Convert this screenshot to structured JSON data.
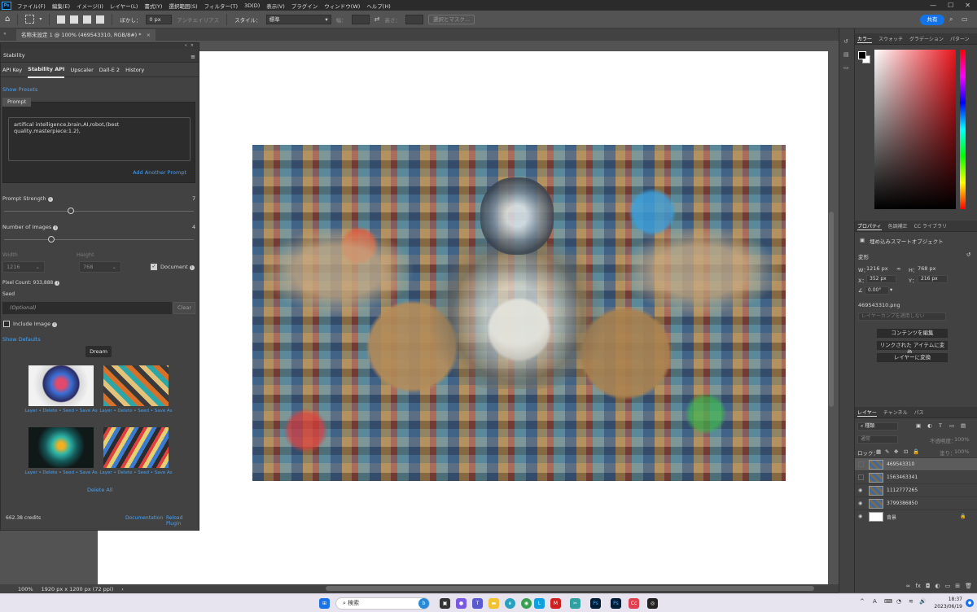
{
  "app": {
    "logo": "Ps",
    "menu": [
      "ファイル(F)",
      "編集(E)",
      "イメージ(I)",
      "レイヤー(L)",
      "書式(Y)",
      "選択範囲(S)",
      "フィルター(T)",
      "3D(D)",
      "表示(V)",
      "プラグイン",
      "ウィンドウ(W)",
      "ヘルプ(H)"
    ],
    "window_controls": [
      "—",
      "☐",
      "✕"
    ]
  },
  "options_bar": {
    "blur_label": "ぼかし：",
    "blur_value": "0 px",
    "antialias_label": "アンチエイリアス",
    "style_label": "スタイル：",
    "style_value": "標準",
    "width_label": "幅：",
    "height_label": "高さ：",
    "select_mask_label": "選択とマスク...",
    "share_label": "共有"
  },
  "document": {
    "tab_title": "名称未設定 1 @ 100% (469543310, RGB/8#) *",
    "zoom": "100%",
    "doc_size": "1920 px x 1200 px (72 ppi)"
  },
  "stability": {
    "panel_title": "Stability",
    "tabs": [
      "API Key",
      "Stability API",
      "Upscaler",
      "Dall-E 2",
      "History"
    ],
    "active_tab": 1,
    "show_presets": "Show Presets",
    "prompt_label": "Prompt",
    "prompt_text": "artifical intelligence,brain,AI,robot,(best quality,masterpiece:1.2),",
    "add_prompt": "Add Another Prompt",
    "prompt_strength_label": "Prompt Strength",
    "prompt_strength_value": "7",
    "prompt_strength_fraction": 0.35,
    "num_images_label": "Number of Images",
    "num_images_value": "4",
    "num_images_fraction": 0.25,
    "width_label": "Width",
    "width_value": "1216",
    "height_label": "Height",
    "height_value": "768",
    "document_label": "Document",
    "document_checked": true,
    "pixel_count": "Pixel Count: 933,888",
    "seed_label": "Seed",
    "seed_placeholder": "(Optional)",
    "clear_label": "Clear",
    "include_image_label": "Include Image",
    "include_image_checked": false,
    "show_defaults": "Show Defaults",
    "dream_label": "Dream",
    "thumb_actions": "Layer • Delete • Seed • Save As",
    "delete_all": "Delete All",
    "credits": "662.38 credits",
    "documentation": "Documentation",
    "reload_plugin": "Reload Plugin"
  },
  "color_panel": {
    "tabs": [
      "カラー",
      "スウォッチ",
      "グラデーション",
      "パターン"
    ]
  },
  "properties_panel": {
    "tabs": [
      "プロパティ",
      "色調補正",
      "CC ライブラリ"
    ],
    "object_type": "埋め込みスマートオブジェクト",
    "transform_label": "変形",
    "w_label": "W：",
    "w_value": "1216 px",
    "h_label": "H：",
    "h_value": "768 px",
    "x_label": "X：",
    "x_value": "352 px",
    "y_label": "Y：",
    "y_value": "216 px",
    "angle_value": "0.00°",
    "file_name": "469543310.png",
    "layer_comp_placeholder": "レイヤーカンプを適用しない",
    "btn_edit_contents": "コンテンツを編集",
    "btn_embed_linked": "リンクされた アイテムに変換...",
    "btn_convert_layer": "レイヤーに変換"
  },
  "layers_panel": {
    "tabs": [
      "レイヤー",
      "チャンネル",
      "パス"
    ],
    "filter_label": "種類",
    "blend_mode": "通常",
    "opacity_label": "不透明度：",
    "opacity_value": "100%",
    "lock_label": "ロック：",
    "fill_label": "塗り：",
    "fill_value": "100%",
    "layers": [
      {
        "name": "469543310",
        "visible": false,
        "selected": true
      },
      {
        "name": "1563463341",
        "visible": false,
        "selected": false
      },
      {
        "name": "1112777265",
        "visible": true,
        "selected": false
      },
      {
        "name": "3799386850",
        "visible": true,
        "selected": false
      },
      {
        "name": "背景",
        "visible": true,
        "selected": false,
        "locked": true
      }
    ]
  },
  "taskbar": {
    "search_label": "検索",
    "time": "18:37",
    "date": "2023/06/19",
    "ime": "A"
  }
}
